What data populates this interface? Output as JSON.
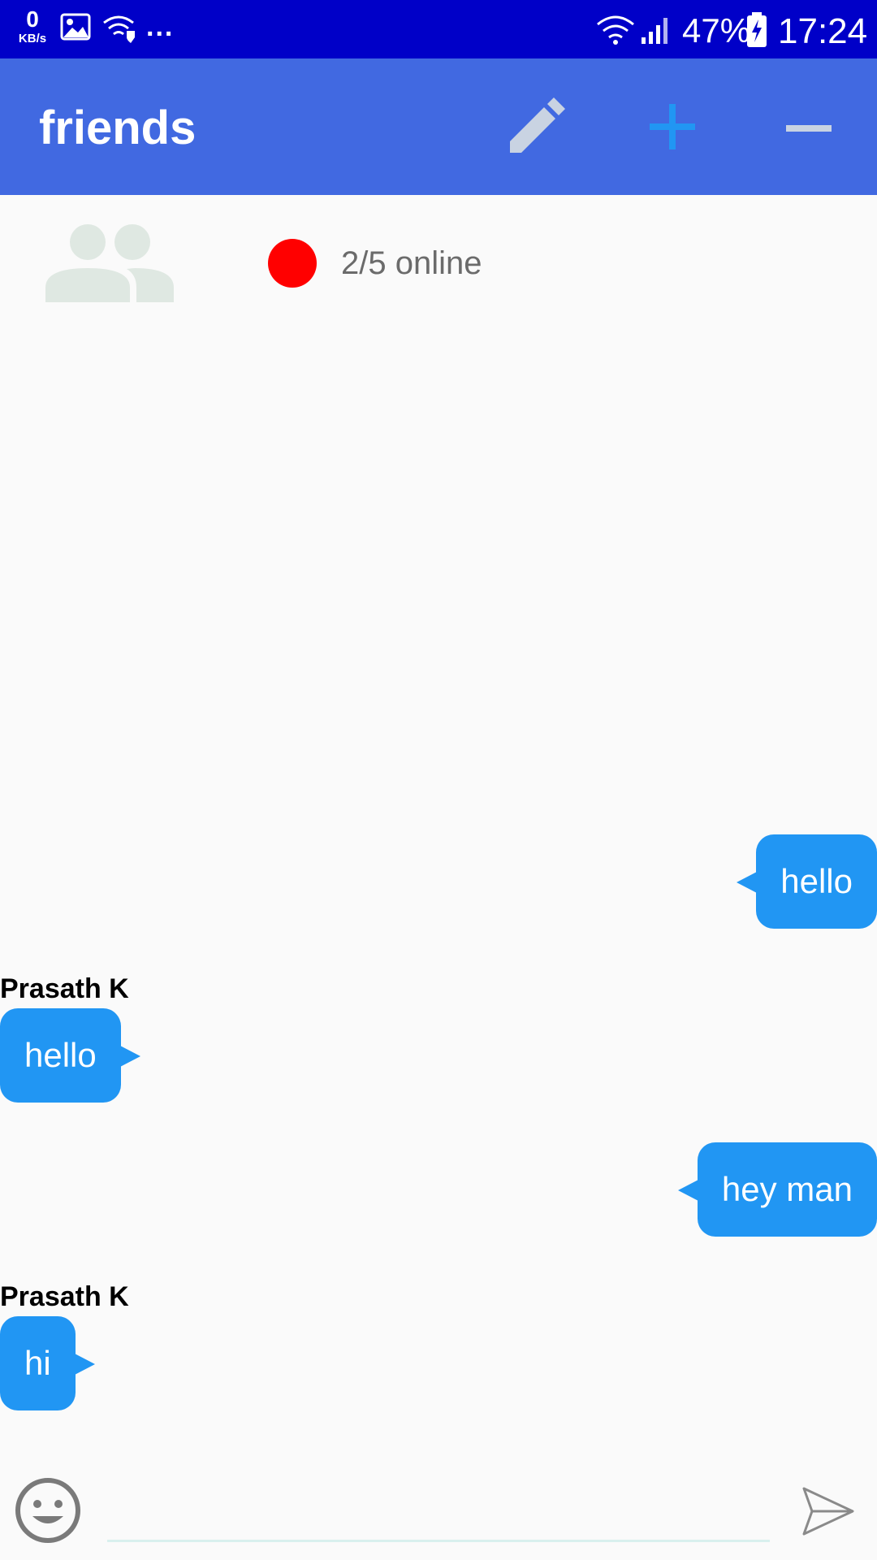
{
  "status_bar": {
    "net_speed_value": "0",
    "net_speed_unit": "KB/s",
    "overflow": "...",
    "battery_percent": "47%",
    "time": "17:24",
    "icons": [
      "gallery-icon",
      "wifi-shield-icon",
      "wifi-icon",
      "signal-icon",
      "battery-charging-icon"
    ]
  },
  "app_bar": {
    "title": "friends",
    "actions": [
      "edit-icon",
      "add-icon",
      "remove-icon"
    ],
    "colors": {
      "background": "#4169e1",
      "edit": "#c9d3e2",
      "add": "#2196f3",
      "remove": "#c9d3e2"
    }
  },
  "group": {
    "avatar_icon": "group-icon",
    "online_status_color": "#ff0000",
    "online_text": "2/5 online"
  },
  "messages": [
    {
      "direction": "outgoing",
      "sender": "",
      "text": "hello"
    },
    {
      "direction": "incoming",
      "sender": "Prasath K",
      "text": "hello"
    },
    {
      "direction": "outgoing",
      "sender": "",
      "text": "hey man"
    },
    {
      "direction": "incoming",
      "sender": "Prasath K",
      "text": "hi"
    }
  ],
  "composer": {
    "emoji_icon": "smiley-icon",
    "input_value": "",
    "input_placeholder": "",
    "send_icon": "send-icon"
  },
  "colors": {
    "bubble": "#2196f3",
    "status_bar": "#0000c8",
    "page_background": "#fafafa"
  }
}
